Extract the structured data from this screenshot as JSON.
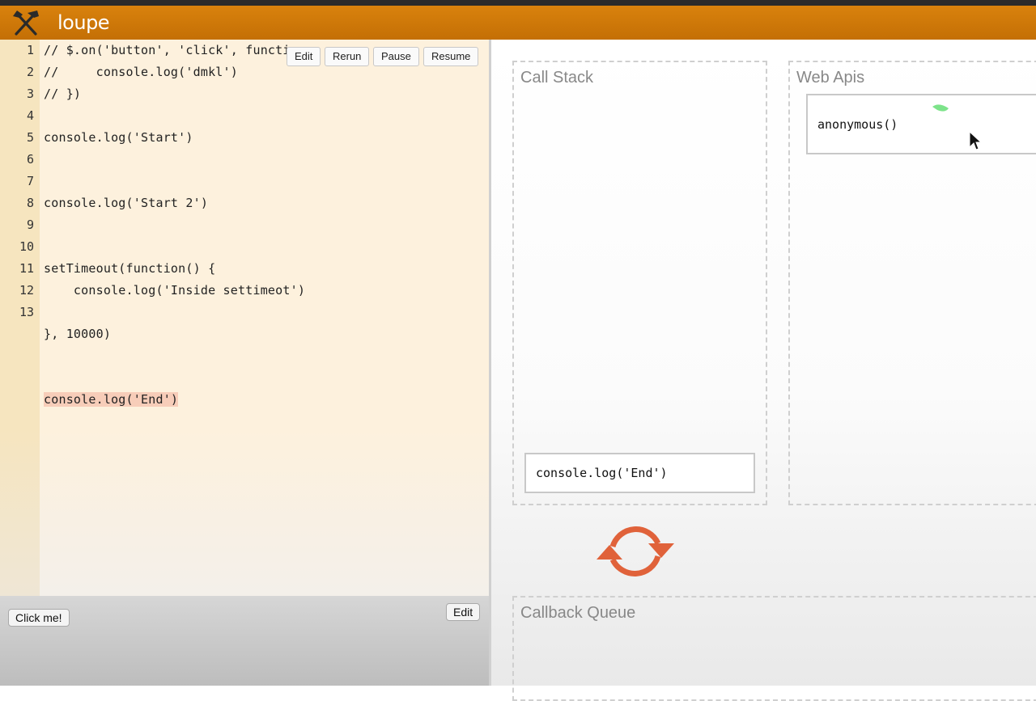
{
  "app": {
    "title": "loupe"
  },
  "editor": {
    "toolbar": {
      "edit": "Edit",
      "rerun": "Rerun",
      "pause": "Pause",
      "resume": "Resume"
    },
    "line_numbers": [
      "1",
      "2",
      "3",
      "4",
      "5",
      "6",
      "7",
      "8",
      "9",
      "10",
      "11",
      "12",
      "13"
    ],
    "code_lines": [
      "// $.on('button', 'click', functi",
      "//     console.log('dmkl')",
      "// })",
      "console.log('Start')",
      "console.log('Start 2')",
      "setTimeout(function() {",
      "    console.log('Inside settimeot')",
      "}, 10000)",
      "console.log('End')"
    ]
  },
  "html_pane": {
    "click_me": "Click me!",
    "edit": "Edit"
  },
  "visualizer": {
    "call_stack": {
      "title": "Call Stack",
      "frames": [
        "console.log('End')"
      ]
    },
    "web_apis": {
      "title": "Web Apis",
      "items": [
        "anonymous()"
      ]
    },
    "callback_queue": {
      "title": "Callback Queue"
    }
  },
  "colors": {
    "header": "#c97505",
    "editor_bg": "#fdf1dd",
    "gutter_bg": "#f6e5bf",
    "highlight_line": "#f7cdb9",
    "loop_arrows": "#e0623a"
  },
  "icons": [
    "tools-logo-icon",
    "event-loop-icon",
    "mouse-cursor-icon"
  ]
}
